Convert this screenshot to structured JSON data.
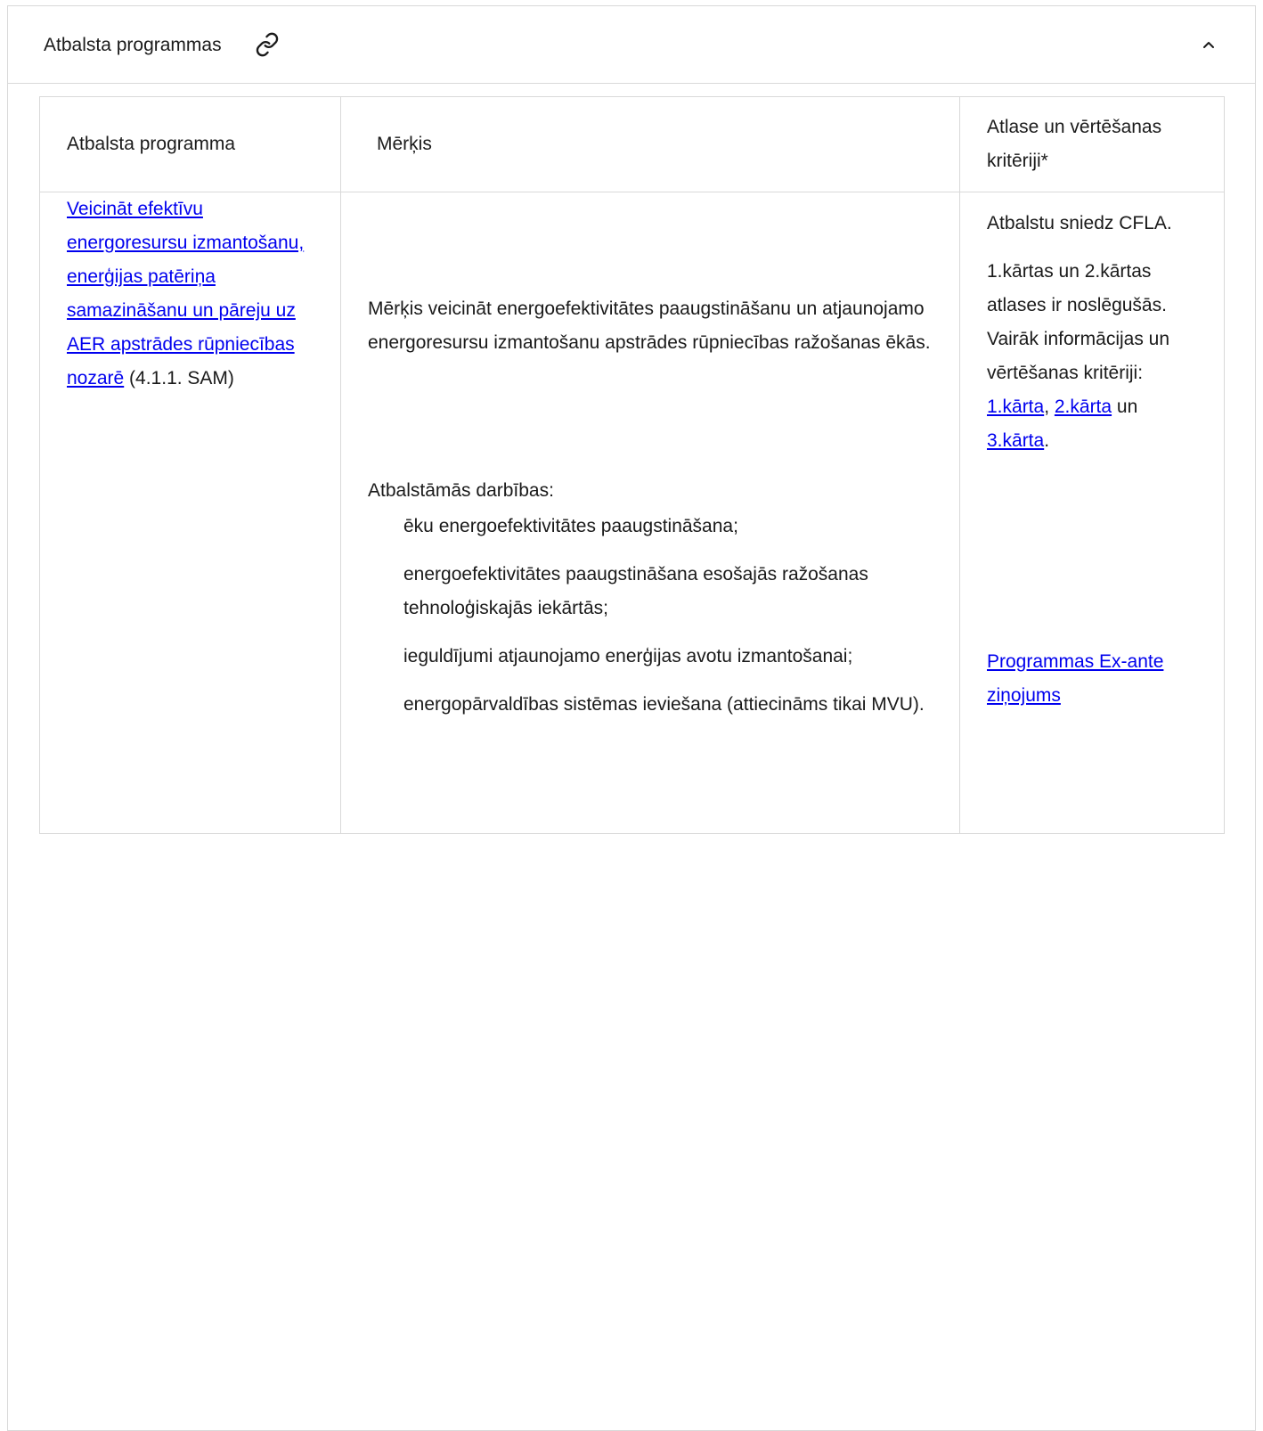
{
  "accordion": {
    "title": "Atbalsta programmas",
    "link_icon": "link-icon",
    "toggle_icon": "chevron-up-icon"
  },
  "table": {
    "headers": {
      "program": "Atbalsta programma",
      "goal": "Mērķis",
      "criteria": "Atlase un vērtēšanas kritēriji*"
    },
    "row": {
      "program_link": "Veicināt efektīvu energoresursu izmantošanu, enerģijas patēriņa samazināšanu un pāreju uz AER apstrādes rūpniecības nozarē",
      "program_suffix": " (4.1.1. SAM)",
      "goal_text": "Mērķis veicināt energoefektivitātes paaugstināšanu un atjaunojamo energoresursu izmantošanu apstrādes rūpniecības ražošanas ēkās.",
      "activities_label": "Atbalstāmās darbības:",
      "activities": [
        "ēku energoefektivitātes paaugstināšana;",
        "energoefektivitātes paaugstināšana esošajās ražošanas tehnoloģiskajās iekārtās;",
        "ieguldījumi atjaunojamo enerģijas avotu izmantošanai;",
        "energopārvaldības sistēmas ieviešana (attiecināms tikai MVU)."
      ],
      "criteria_provider": "Atbalstu sniedz CFLA.",
      "criteria_text": "1.kārtas un 2.kārtas atlases ir noslēgušās. Vairāk informācijas un vērtēšanas kritēriji: ",
      "round1_link": "1.kārta",
      "sep1": ", ",
      "round2_link": "2.kārta",
      "sep2": " un ",
      "round3_link": "3.kārta",
      "end": ".",
      "exante_link": "Programmas Ex-ante ziņojums"
    }
  },
  "colors": {
    "link": "#0000ee",
    "border": "#d9d9d9",
    "text": "#1a1a1a"
  }
}
